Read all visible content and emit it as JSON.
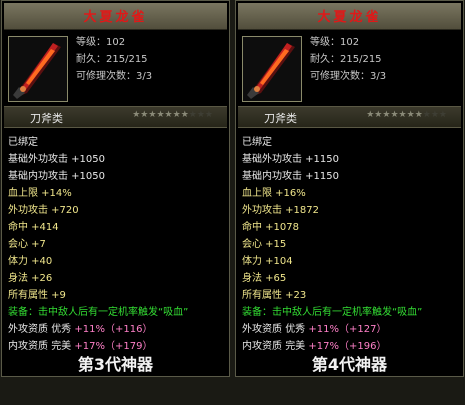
{
  "panels": [
    {
      "title": "大夏龙雀",
      "level": "等级：102",
      "durability": "耐久：215/215",
      "repairs": "可修理次数：3/3",
      "category": "刀斧类",
      "icon": "sword-icon",
      "stars_filled": 7,
      "stars_total": 10,
      "bound": "已绑定",
      "stats": [
        "基础外功攻击 +1050",
        "基础内功攻击 +1050"
      ],
      "bonuses": [
        "血上限 +14%",
        "外功攻击 +720",
        "命中 +414",
        "会心 +7",
        "体力 +40",
        "身法 +26",
        "所有属性 +9"
      ],
      "equip_effect": "装备：击中敌人后有一定机率触发“吸血”",
      "aptitude": [
        {
          "label": "外攻资质",
          "grade": "优秀",
          "value": "+11%（+116）"
        },
        {
          "label": "内攻资质",
          "grade": "完美",
          "value": "+17%（+179）"
        }
      ],
      "caption": "第3代神器"
    },
    {
      "title": "大夏龙雀",
      "level": "等级：102",
      "durability": "耐久：215/215",
      "repairs": "可修理次数：3/3",
      "category": "刀斧类",
      "icon": "sword-icon",
      "stars_filled": 7,
      "stars_total": 10,
      "bound": "已绑定",
      "stats": [
        "基础外功攻击 +1150",
        "基础内功攻击 +1150"
      ],
      "bonuses": [
        "血上限 +16%",
        "外功攻击 +1872",
        "命中 +1078",
        "会心 +15",
        "体力 +104",
        "身法 +65",
        "所有属性 +23"
      ],
      "equip_effect": "装备：击中敌人后有一定机率触发“吸血”",
      "aptitude": [
        {
          "label": "外攻资质",
          "grade": "优秀",
          "value": "+11%（+127）"
        },
        {
          "label": "内攻资质",
          "grade": "完美",
          "value": "+17%（+196）"
        }
      ],
      "caption": "第4代神器"
    }
  ],
  "colors": {
    "title": "#e01818",
    "bonus": "#f0e68c",
    "effect": "#33dd33",
    "aptitude_value": "#ff80c8"
  }
}
